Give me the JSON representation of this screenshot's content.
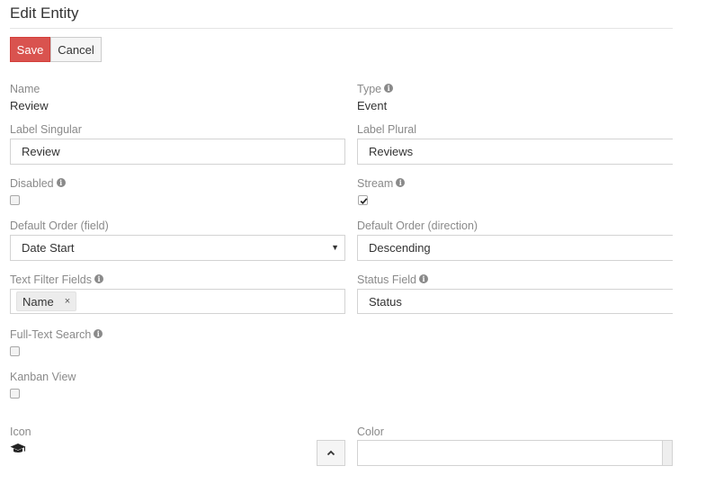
{
  "page": {
    "title": "Edit Entity"
  },
  "toolbar": {
    "save_label": "Save",
    "cancel_label": "Cancel"
  },
  "fields": {
    "name": {
      "label": "Name",
      "value": "Review"
    },
    "type": {
      "label": "Type",
      "value": "Event"
    },
    "label_singular": {
      "label": "Label Singular",
      "value": "Review"
    },
    "label_plural": {
      "label": "Label Plural",
      "value": "Reviews"
    },
    "disabled": {
      "label": "Disabled",
      "checked": false
    },
    "stream": {
      "label": "Stream",
      "checked": true
    },
    "default_order_field": {
      "label": "Default Order (field)",
      "value": "Date Start"
    },
    "default_order_direction": {
      "label": "Default Order (direction)",
      "value": "Descending"
    },
    "text_filter_fields": {
      "label": "Text Filter Fields",
      "chips": [
        "Name"
      ],
      "chip_remove": "×"
    },
    "status_field": {
      "label": "Status Field",
      "value": "Status"
    },
    "full_text_search": {
      "label": "Full-Text Search",
      "checked": false
    },
    "kanban_view": {
      "label": "Kanban View",
      "checked": false
    },
    "icon": {
      "label": "Icon",
      "value_icon": "graduation-cap-icon"
    },
    "color": {
      "label": "Color",
      "value": ""
    }
  },
  "icons": {
    "info": "info-circle-icon",
    "select": "caret-down-icon",
    "toggle": "chevron-up-icon"
  },
  "colors": {
    "save": "#d9534f",
    "muted_label": "#8a8a8a",
    "border": "#d3d3d3"
  }
}
